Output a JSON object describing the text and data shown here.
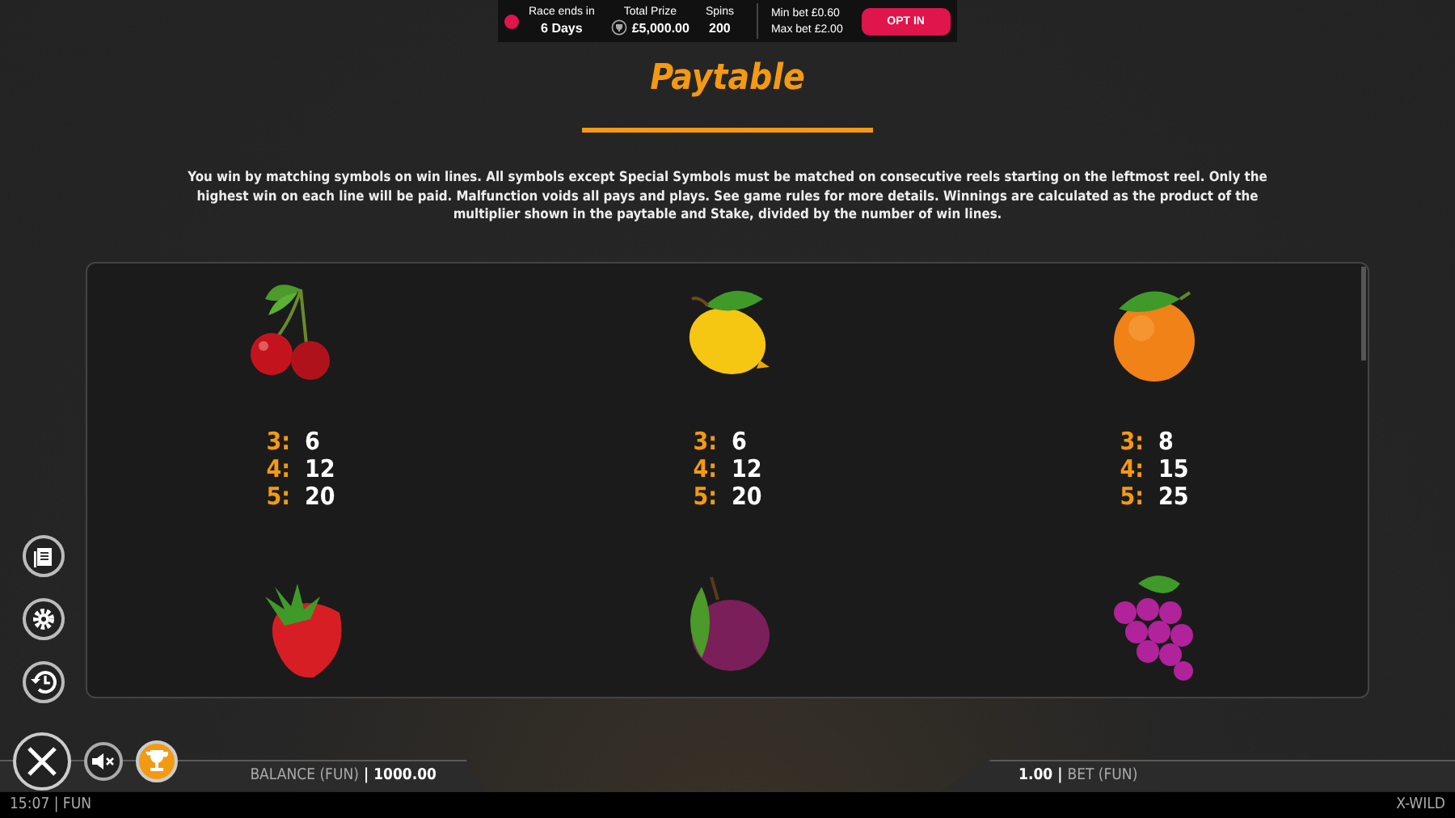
{
  "banner": {
    "race_label": "Race ends in",
    "race_value": "6 Days",
    "prize_label": "Total Prize",
    "prize_value": "£5,000.00",
    "spins_label": "Spins",
    "spins_value": "200",
    "min_bet": "Min bet £0.60",
    "max_bet": "Max bet £2.00",
    "button": "OPT IN"
  },
  "title": "Paytable",
  "description": "You win by matching symbols on win lines. All symbols except Special Symbols must be matched on consecutive reels starting on the leftmost reel. Only the highest win on each line will be paid. Malfunction voids all pays and plays. See game rules for more details. Winnings are calculated as the product of the multiplier shown in the paytable and Stake, divided by the number of win lines.",
  "symbols": [
    {
      "kind": "cherry",
      "pays": [
        {
          "count": "3:",
          "value": "6"
        },
        {
          "count": "4:",
          "value": "12"
        },
        {
          "count": "5:",
          "value": "20"
        }
      ]
    },
    {
      "kind": "lemon",
      "pays": [
        {
          "count": "3:",
          "value": "6"
        },
        {
          "count": "4:",
          "value": "12"
        },
        {
          "count": "5:",
          "value": "20"
        }
      ]
    },
    {
      "kind": "orange",
      "pays": [
        {
          "count": "3:",
          "value": "8"
        },
        {
          "count": "4:",
          "value": "15"
        },
        {
          "count": "5:",
          "value": "25"
        }
      ]
    },
    {
      "kind": "strawberry"
    },
    {
      "kind": "plum"
    },
    {
      "kind": "grapes"
    }
  ],
  "side_buttons": [
    {
      "kind": "pages"
    },
    {
      "kind": "settings"
    },
    {
      "kind": "history"
    }
  ],
  "bottom": {
    "balance_label": "BALANCE (FUN)",
    "balance_separator": "|",
    "balance_value": "1000.00",
    "bet_value": "1.00",
    "bet_separator": "|",
    "bet_label": "BET  (FUN)"
  },
  "footer": {
    "clock": "15:07 | FUN",
    "game": "X-WILD"
  }
}
